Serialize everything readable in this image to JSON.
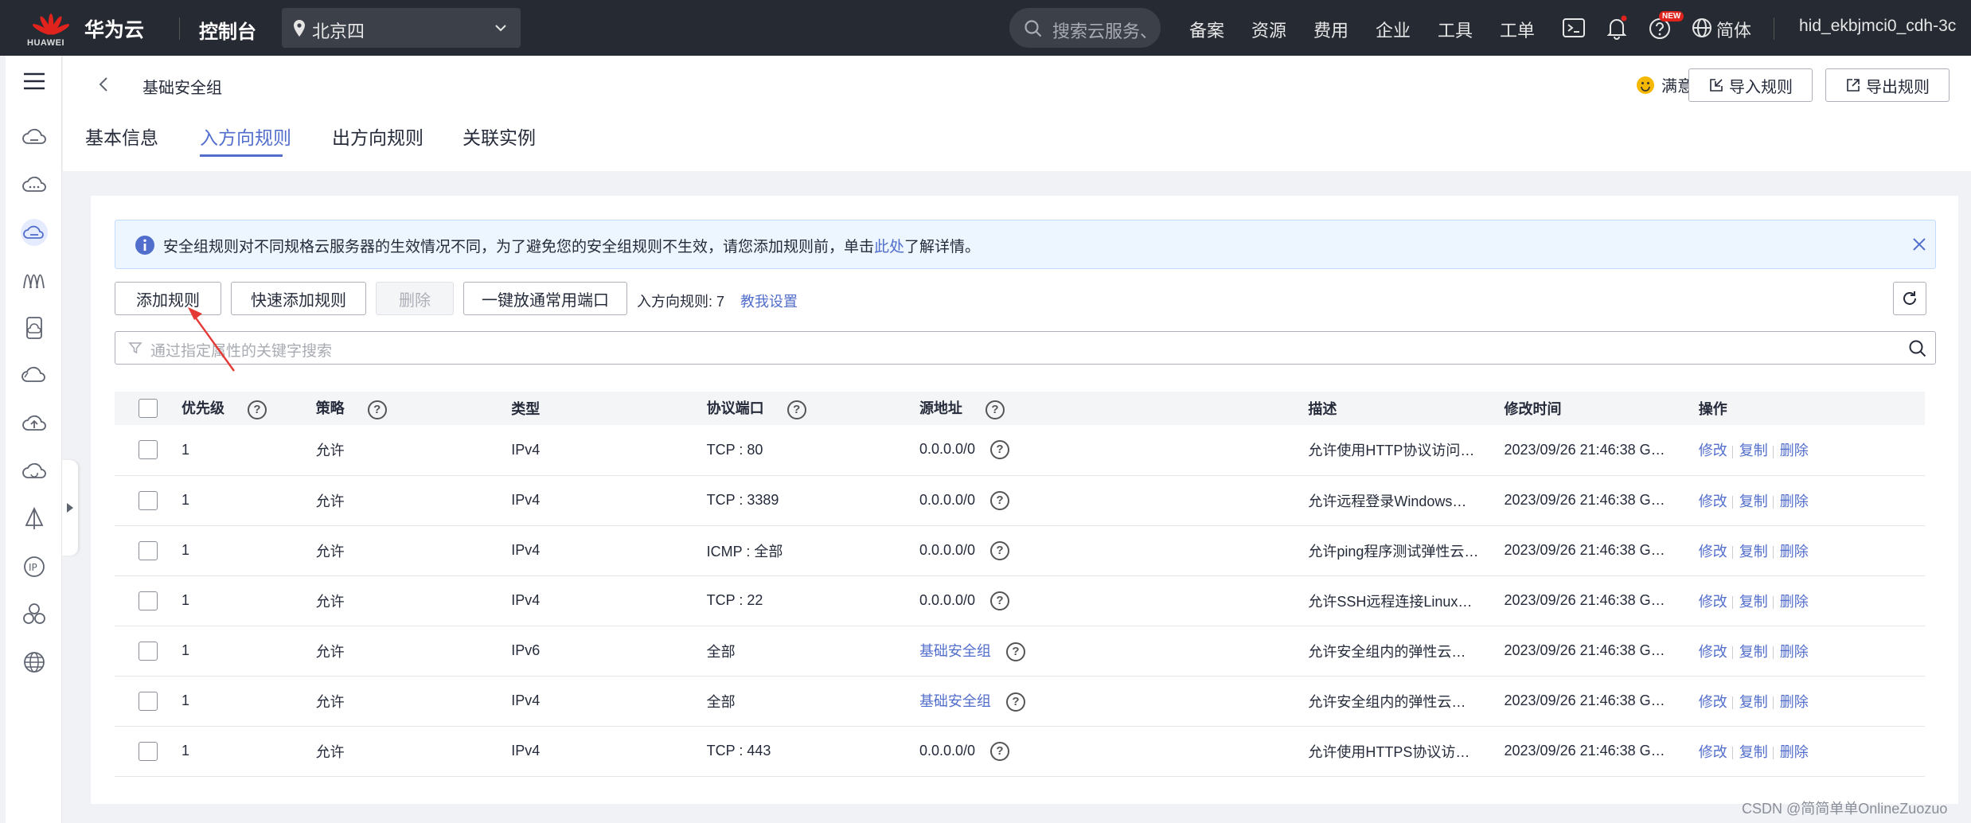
{
  "topbar": {
    "logo_word": "HUAWEI",
    "brand": "华为云",
    "console": "控制台",
    "region": "北京四",
    "search_placeholder": "搜索云服务、",
    "menu": [
      "备案",
      "资源",
      "费用",
      "企业",
      "工具",
      "工单"
    ],
    "new_badge": "NEW",
    "language": "简体",
    "username": "hid_ekbjmci0_cdh-3c"
  },
  "header": {
    "breadcrumb": "基础安全组",
    "tabs": [
      "基本信息",
      "入方向规则",
      "出方向规则",
      "关联实例"
    ],
    "active_tab": "入方向规则",
    "satisfaction": "满意度评价",
    "import_label": "导入规则",
    "export_label": "导出规则"
  },
  "notice": {
    "text_before": "安全组规则对不同规格云服务器的生效情况不同，为了避免您的安全组规则不生效，请您添加规则前，单击",
    "link": "此处",
    "text_after": "了解详情。"
  },
  "toolbar": {
    "add": "添加规则",
    "quick_add": "快速添加规则",
    "delete": "删除",
    "open_ports": "一键放通常用端口",
    "count": "入方向规则: 7",
    "help_link": "教我设置"
  },
  "filter": {
    "placeholder": "通过指定属性的关键字搜索"
  },
  "table": {
    "columns": [
      "优先级",
      "策略",
      "类型",
      "协议端口",
      "源地址",
      "描述",
      "修改时间",
      "操作"
    ],
    "actions": [
      "修改",
      "复制",
      "删除"
    ],
    "rows": [
      {
        "priority": "1",
        "policy": "允许",
        "type": "IPv4",
        "port": "TCP : 80",
        "source": "0.0.0.0/0",
        "source_link": false,
        "desc": "允许使用HTTP协议访问…",
        "time": "2023/09/26 21:46:38 G…"
      },
      {
        "priority": "1",
        "policy": "允许",
        "type": "IPv4",
        "port": "TCP : 3389",
        "source": "0.0.0.0/0",
        "source_link": false,
        "desc": "允许远程登录Windows…",
        "time": "2023/09/26 21:46:38 G…"
      },
      {
        "priority": "1",
        "policy": "允许",
        "type": "IPv4",
        "port": "ICMP : 全部",
        "source": "0.0.0.0/0",
        "source_link": false,
        "desc": "允许ping程序测试弹性云…",
        "time": "2023/09/26 21:46:38 G…"
      },
      {
        "priority": "1",
        "policy": "允许",
        "type": "IPv4",
        "port": "TCP : 22",
        "source": "0.0.0.0/0",
        "source_link": false,
        "desc": "允许SSH远程连接Linux…",
        "time": "2023/09/26 21:46:38 G…"
      },
      {
        "priority": "1",
        "policy": "允许",
        "type": "IPv6",
        "port": "全部",
        "source": "基础安全组",
        "source_link": true,
        "desc": "允许安全组内的弹性云…",
        "time": "2023/09/26 21:46:38 G…"
      },
      {
        "priority": "1",
        "policy": "允许",
        "type": "IPv4",
        "port": "全部",
        "source": "基础安全组",
        "source_link": true,
        "desc": "允许安全组内的弹性云…",
        "time": "2023/09/26 21:46:38 G…"
      },
      {
        "priority": "1",
        "policy": "允许",
        "type": "IPv4",
        "port": "TCP : 443",
        "source": "0.0.0.0/0",
        "source_link": false,
        "desc": "允许使用HTTPS协议访…",
        "time": "2023/09/26 21:46:38 G…"
      }
    ]
  },
  "watermark": "CSDN @简简单单OnlineZuozuo",
  "colors": {
    "topbar": "#262a33",
    "accent": "#526ecc",
    "annotation_arrow": "#e53935"
  }
}
